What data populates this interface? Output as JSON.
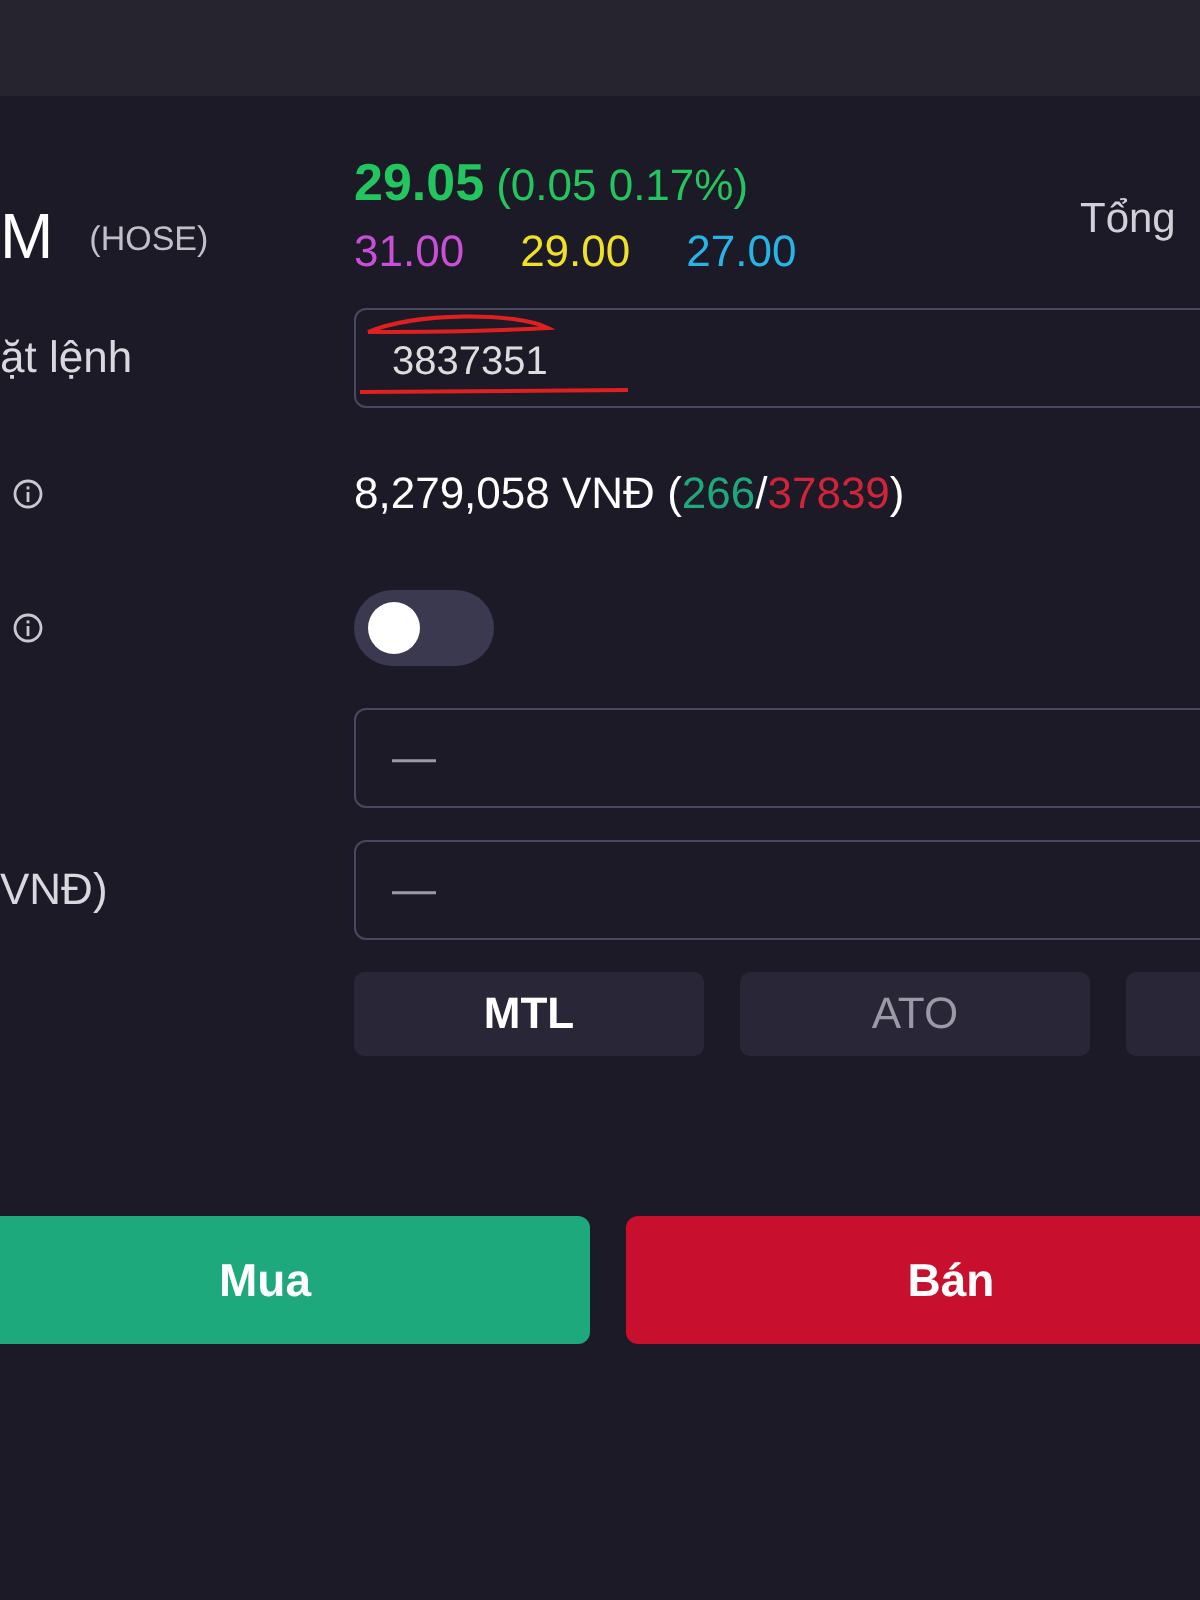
{
  "symbol": {
    "ticker": "M",
    "exchange": "(HOSE)"
  },
  "quote": {
    "price": "29.05",
    "change": "(0.05 0.17%)",
    "ceiling": "31.00",
    "reference": "29.00",
    "floor": "27.00"
  },
  "header_right": "Tổng",
  "account": {
    "label": "ặt lệnh",
    "value": "3837351"
  },
  "buying_power": {
    "amount": "8,279,058 VNĐ",
    "open": "(",
    "buy_count": "266",
    "separator": "/",
    "sell_count": "37839",
    "close": ")"
  },
  "toggle": {
    "on": false
  },
  "quantity": {
    "placeholder": "—"
  },
  "price_field": {
    "label": "VNĐ)",
    "placeholder": "—"
  },
  "order_types": [
    {
      "label": "MTL",
      "selected": true
    },
    {
      "label": "ATO",
      "selected": false
    }
  ],
  "actions": [
    {
      "label": "Mua",
      "kind": "buy"
    },
    {
      "label": "Bán",
      "kind": "sell"
    }
  ]
}
